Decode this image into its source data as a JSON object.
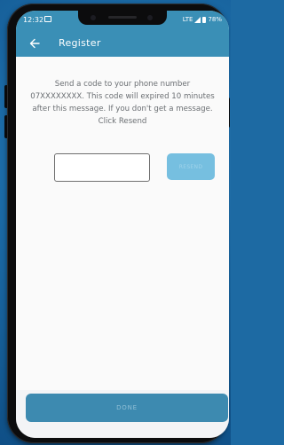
{
  "status_bar": {
    "time": "12:32",
    "network": "LTE",
    "battery": "78%"
  },
  "appbar": {
    "title": "Register",
    "back_icon": "arrow-left-icon"
  },
  "message": "Send a code to your phone number 07XXXXXXXX. This code will expired 10 minutes after this message. If you don't get a message. Click Resend",
  "code_input": {
    "value": "",
    "placeholder": ""
  },
  "resend_button": {
    "label": "RESEND"
  },
  "done_button": {
    "label": "DONE"
  },
  "colors": {
    "primary": "#3a8fb6",
    "resend_disabled": "#76bfe0",
    "background_outer": "#1d6aa3"
  }
}
